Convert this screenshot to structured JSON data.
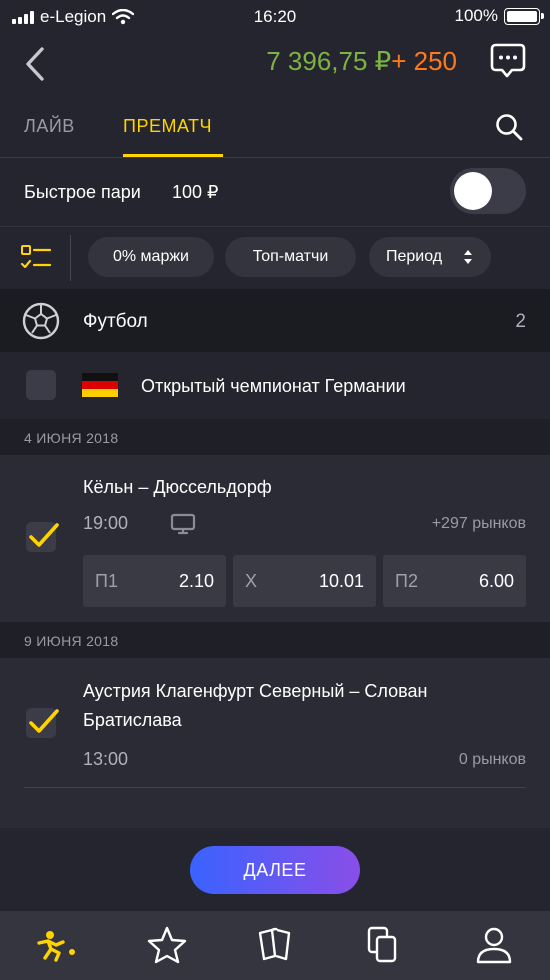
{
  "status_bar": {
    "carrier": "e-Legion",
    "time": "16:20",
    "battery": "100%"
  },
  "header": {
    "balance_main": "7 396,75 ₽",
    "balance_bonus": "+ 250"
  },
  "tabs": [
    {
      "label": "ЛАЙВ",
      "active": false
    },
    {
      "label": "ПРЕМАТЧ",
      "active": true
    }
  ],
  "quick_bet": {
    "label": "Быстрое пари",
    "amount": "100 ₽",
    "enabled": false
  },
  "filters": {
    "margin": "0% маржи",
    "top": "Топ-матчи",
    "period": "Период"
  },
  "sport": {
    "name": "Футбол",
    "count": "2"
  },
  "league": {
    "name": "Открытый чемпионат Германии",
    "checked": false
  },
  "events": [
    {
      "date": "4 ИЮНЯ 2018",
      "title": "Кёльн – Дюссельдорф",
      "time": "19:00",
      "markets": "+297 рынков",
      "checked": true,
      "odds": [
        {
          "k": "П1",
          "v": "2.10"
        },
        {
          "k": "X",
          "v": "10.01"
        },
        {
          "k": "П2",
          "v": "6.00"
        }
      ]
    },
    {
      "date": "9 ИЮНЯ 2018",
      "title_line1": "Аустрия Клагенфурт Северный – Слован",
      "title_line2": "Братислава",
      "time": "13:00",
      "markets": "0 рынков",
      "checked": true
    }
  ],
  "next_button": "ДАЛЕЕ",
  "tabbar": [
    "sports-icon",
    "star-icon",
    "cards-icon",
    "coupons-icon",
    "profile-icon"
  ],
  "colors": {
    "accent": "#ffd400",
    "balance": "#7cb342",
    "bonus": "#ff7a1a"
  }
}
